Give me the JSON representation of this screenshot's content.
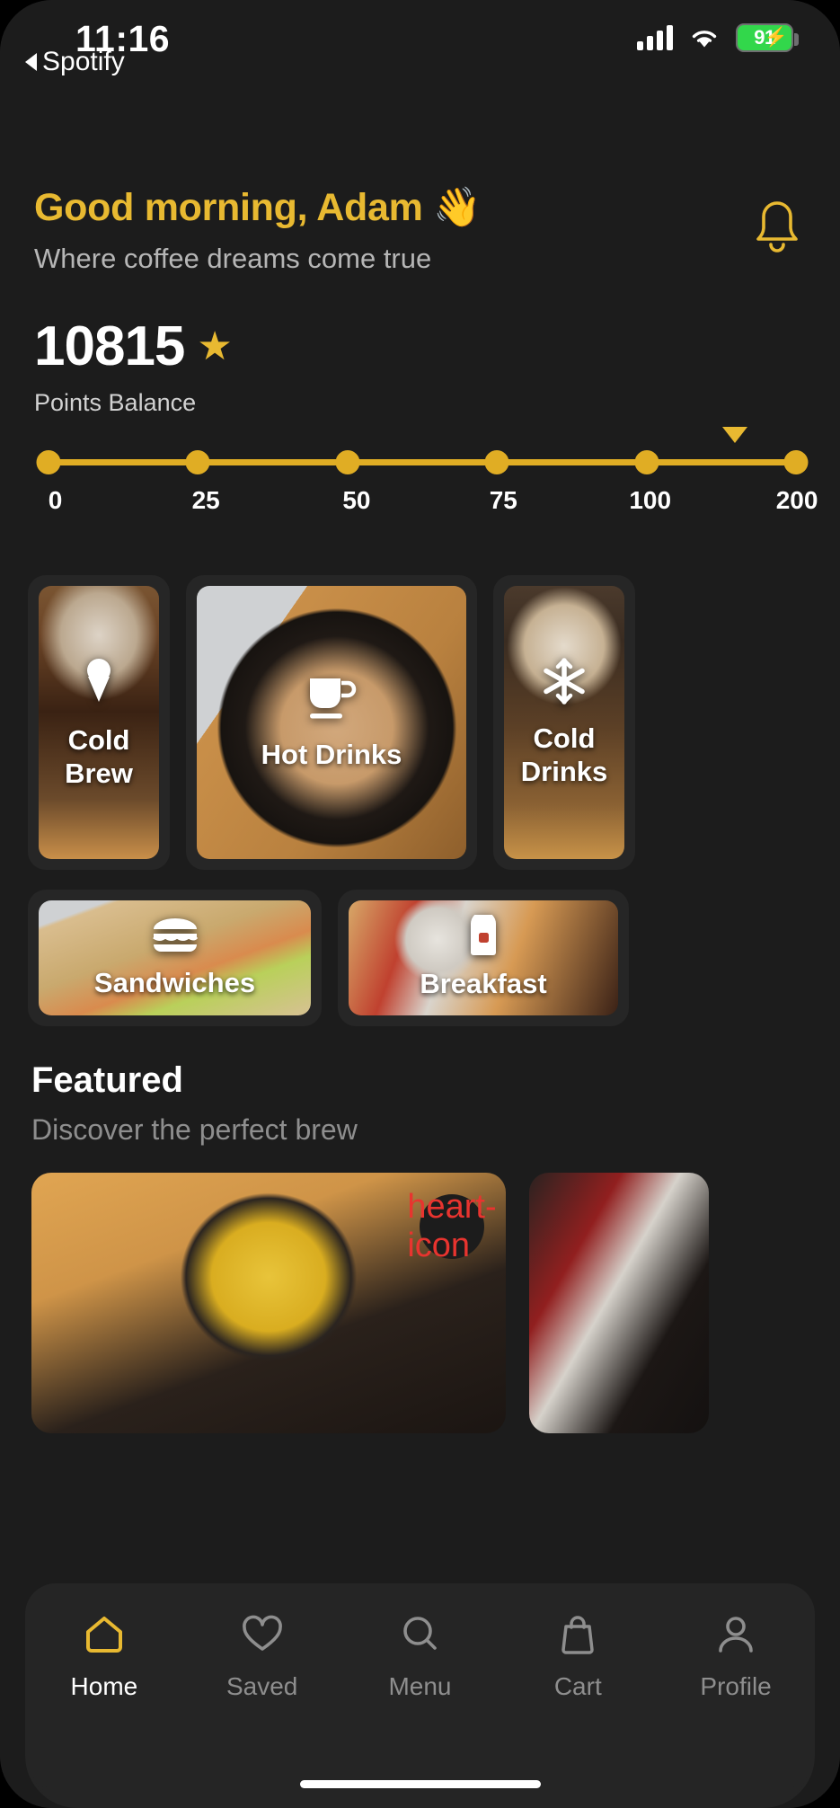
{
  "status_bar": {
    "time": "11:16",
    "back_app": "Spotify",
    "battery_percent": "91",
    "signal_icon": "cellular-signal-icon",
    "wifi_icon": "wifi-icon",
    "battery_icon": "battery-charging-icon"
  },
  "header": {
    "greeting": "Good morning, Adam 👋",
    "subtitle": "Where coffee dreams come true",
    "bell_icon": "notification-bell-icon"
  },
  "points": {
    "value": "10815",
    "star_icon": "★",
    "label": "Points Balance",
    "accent_color": "#e8b931"
  },
  "progress": {
    "ticks": [
      "0",
      "25",
      "50",
      "75",
      "100",
      "200"
    ],
    "marker_position_index": 5,
    "track_color": "#e0ad24"
  },
  "categories": {
    "row1": [
      {
        "label": "Cold\nBrew",
        "label_line1": "Cold",
        "label_line2": "Brew",
        "icon": "ice-cream-cone-icon"
      },
      {
        "label": "Hot Drinks",
        "label_line1": "Hot Drinks",
        "label_line2": "",
        "icon": "coffee-cup-icon"
      },
      {
        "label": "Cold\nDrinks",
        "label_line1": "Cold",
        "label_line2": "Drinks",
        "icon": "snowflake-icon"
      }
    ],
    "row2": [
      {
        "label": "Sandwiches",
        "icon": "burger-icon"
      },
      {
        "label": "Breakfast",
        "icon": "bread-slice-icon"
      }
    ]
  },
  "featured": {
    "title": "Featured",
    "subtitle": "Discover the perfect brew",
    "favorite_icon": "heart-icon"
  },
  "tabbar": {
    "items": [
      {
        "label": "Home",
        "icon": "home-icon",
        "active": true
      },
      {
        "label": "Saved",
        "icon": "heart-outline-icon",
        "active": false
      },
      {
        "label": "Menu",
        "icon": "search-icon",
        "active": false
      },
      {
        "label": "Cart",
        "icon": "shopping-bag-icon",
        "active": false
      },
      {
        "label": "Profile",
        "icon": "person-icon",
        "active": false
      }
    ],
    "active_color": "#e8b931",
    "inactive_color": "#8e8e8e"
  }
}
